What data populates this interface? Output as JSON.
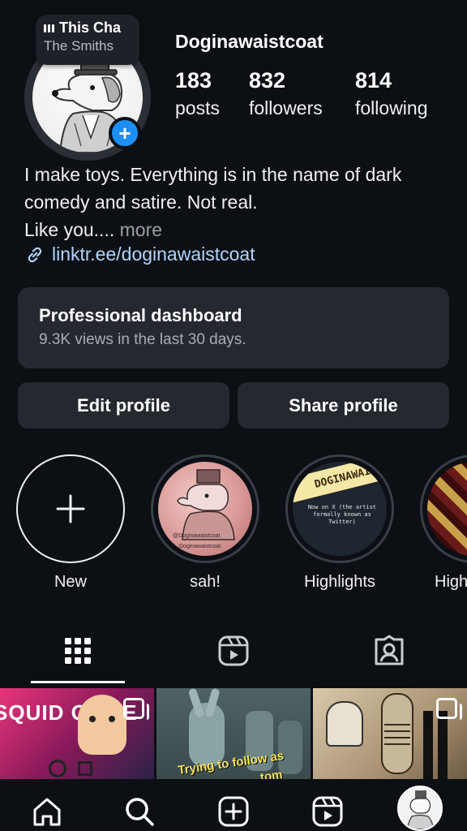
{
  "profile": {
    "username": "Doginawaistcoat",
    "music": {
      "title": "This Cha",
      "artist": "The Smiths"
    },
    "stats": [
      {
        "value": "183",
        "label": "posts"
      },
      {
        "value": "832",
        "label": "followers"
      },
      {
        "value": "814",
        "label": "following"
      }
    ],
    "bio": {
      "line1": "I make toys. Everything is in the name of dark",
      "line2": "comedy and satire. Not real.",
      "line3": "Like you....",
      "more": "more"
    },
    "link": "linktr.ee/doginawaistcoat"
  },
  "dashboard": {
    "title": "Professional dashboard",
    "subtitle": "9.3K views in the last 30 days."
  },
  "buttons": {
    "edit": "Edit profile",
    "share": "Share profile"
  },
  "highlights": [
    {
      "label": "New",
      "image_text": ""
    },
    {
      "label": "sah!",
      "image_text": "@Doginawaistcoat"
    },
    {
      "label": "Highlights",
      "image_text": "Now on X (the artist formally known as Twitter)"
    },
    {
      "label": "High",
      "image_text": ""
    }
  ],
  "highlight_art": {
    "sah_handle": "Doginawaistcoat",
    "highlights_banner": "DOGINAWAISTC"
  },
  "grid": [
    {
      "caption": "SQUID GAME"
    },
    {
      "caption": "Trying to follow as",
      "caption2": "tom"
    },
    {
      "caption": ""
    }
  ],
  "icons": {
    "add_story": "plus-icon",
    "link": "link-icon",
    "tabs": [
      "grid-icon",
      "reels-icon",
      "tagged-icon"
    ],
    "nav": [
      "home-icon",
      "search-icon",
      "create-icon",
      "reels-icon",
      "profile-avatar"
    ]
  },
  "colors": {
    "background": "#0c1015",
    "card": "#25292f",
    "accent": "#1b8ff5",
    "link": "#b3d4fc"
  }
}
